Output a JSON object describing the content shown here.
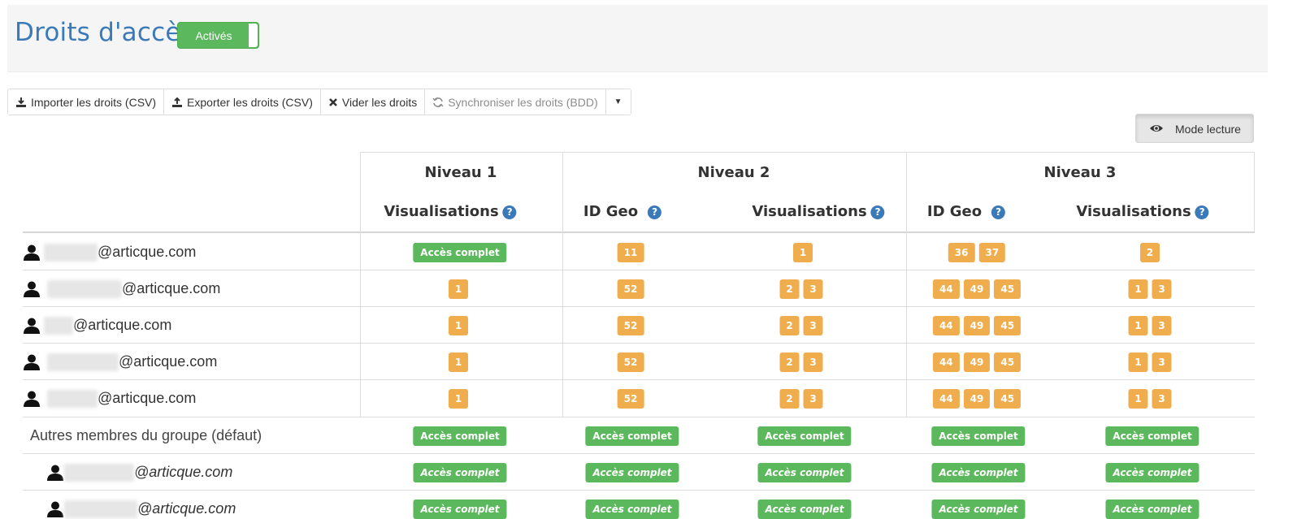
{
  "page_title": "Droits d'accès",
  "toggle_label": "Activés",
  "toolbar": {
    "import_label": "Importer les droits (CSV)",
    "export_label": "Exporter les droits (CSV)",
    "clear_label": "Vider les droits",
    "sync_label": "Synchroniser les droits (BDD)"
  },
  "mode_label": "Mode lecture",
  "table": {
    "levels": [
      "Niveau 1",
      "Niveau 2",
      "Niveau 3"
    ],
    "sub_headers": {
      "visualisations": "Visualisations",
      "id_geo": "ID Geo",
      "help": "?"
    },
    "domain": "@articque.com",
    "group_label": "Autres membres du groupe (défaut)",
    "full_access": "Accès complet",
    "rows": [
      {
        "n1": [
          "Accès complet"
        ],
        "n2_geo": [
          "11"
        ],
        "n2_vis": [
          "1"
        ],
        "n3_geo": [
          "36",
          "37"
        ],
        "n3_vis": [
          "2"
        ]
      },
      {
        "n1": [
          "1"
        ],
        "n2_geo": [
          "52"
        ],
        "n2_vis": [
          "2",
          "3"
        ],
        "n3_geo": [
          "44",
          "49",
          "45"
        ],
        "n3_vis": [
          "1",
          "3"
        ]
      },
      {
        "n1": [
          "1"
        ],
        "n2_geo": [
          "52"
        ],
        "n2_vis": [
          "2",
          "3"
        ],
        "n3_geo": [
          "44",
          "49",
          "45"
        ],
        "n3_vis": [
          "1",
          "3"
        ]
      },
      {
        "n1": [
          "1"
        ],
        "n2_geo": [
          "52"
        ],
        "n2_vis": [
          "2",
          "3"
        ],
        "n3_geo": [
          "44",
          "49",
          "45"
        ],
        "n3_vis": [
          "1",
          "3"
        ]
      },
      {
        "n1": [
          "1"
        ],
        "n2_geo": [
          "52"
        ],
        "n2_vis": [
          "2",
          "3"
        ],
        "n3_geo": [
          "44",
          "49",
          "45"
        ],
        "n3_vis": [
          "1",
          "3"
        ]
      }
    ]
  }
}
